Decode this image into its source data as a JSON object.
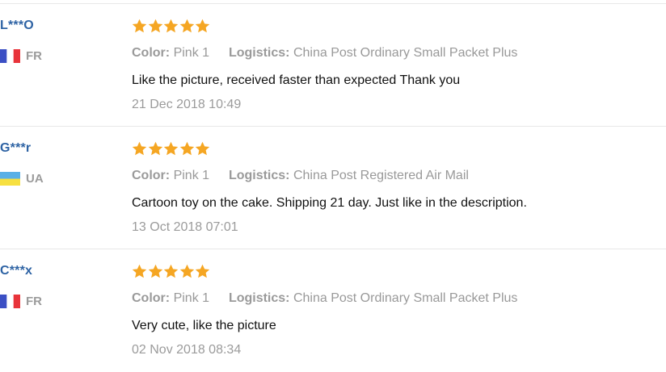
{
  "icons": {
    "star": "star-icon",
    "flag": "country-flag-icon"
  },
  "colors": {
    "username": "#2e63a4",
    "star": "#f5a623",
    "muted": "#9b9b9b",
    "text": "#111111",
    "divider": "#e8e8e8"
  },
  "labels": {
    "color": "Color:",
    "logistics": "Logistics:"
  },
  "reviews": [
    {
      "user": "L***O",
      "country": "FR",
      "rating": 5,
      "color": "Pink 1",
      "logistics": "China Post Ordinary Small Packet Plus",
      "feedback": "Like the picture, received faster than expected Thank you",
      "date": "21 Dec 2018 10:49"
    },
    {
      "user": "G***r",
      "country": "UA",
      "rating": 5,
      "color": "Pink 1",
      "logistics": "China Post Registered Air Mail",
      "feedback": "Cartoon toy on the cake. Shipping 21 day. Just like in the description.",
      "date": "13 Oct 2018 07:01"
    },
    {
      "user": "C***x",
      "country": "FR",
      "rating": 5,
      "color": "Pink 1",
      "logistics": "China Post Ordinary Small Packet Plus",
      "feedback": "Very cute, like the picture",
      "date": "02 Nov 2018 08:34"
    }
  ]
}
